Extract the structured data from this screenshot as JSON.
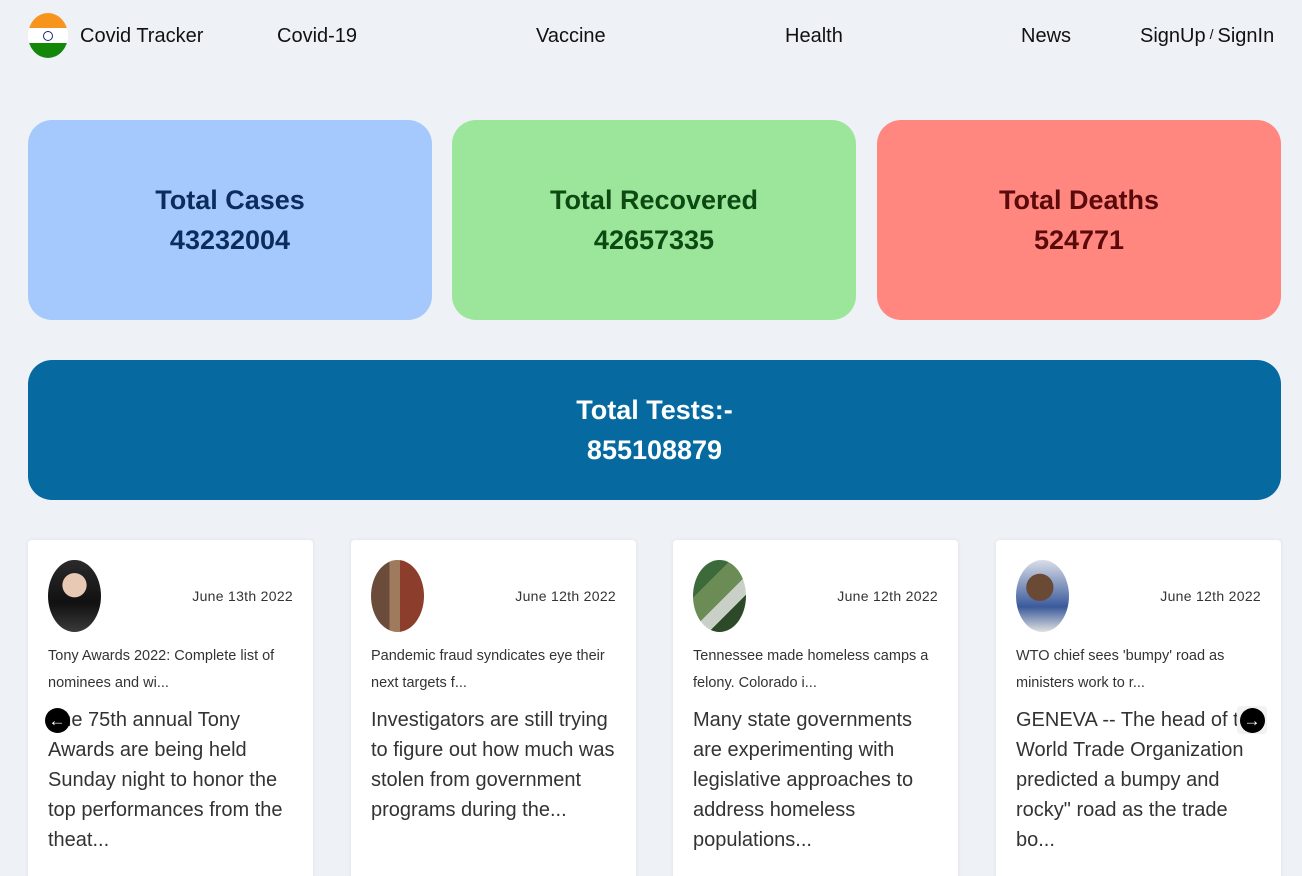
{
  "nav": {
    "brand": "Covid Tracker",
    "items": [
      "Covid-19",
      "Vaccine",
      "Health",
      "News"
    ],
    "signup": "SignUp",
    "separator": "/",
    "signin": "SignIn"
  },
  "stats": {
    "cases": {
      "label": "Total Cases",
      "value": "43232004"
    },
    "recovered": {
      "label": "Total Recovered",
      "value": "42657335"
    },
    "deaths": {
      "label": "Total Deaths",
      "value": "524771"
    },
    "tests": {
      "label": "Total Tests:-",
      "value": "855108879"
    }
  },
  "news": [
    {
      "date": "June 13th 2022",
      "headline": "Tony Awards 2022: Complete list of nominees and wi...",
      "description": "The 75th annual Tony Awards are being held Sunday night to honor the top performances from the theat..."
    },
    {
      "date": "June 12th 2022",
      "headline": "Pandemic fraud syndicates eye their next targets f...",
      "description": "Investigators are still trying to figure out how much was stolen from government programs during the..."
    },
    {
      "date": "June 12th 2022",
      "headline": "Tennessee made homeless camps a felony. Colorado i...",
      "description": "Many state governments are experimenting with legislative approaches to address homeless populations..."
    },
    {
      "date": "June 12th 2022",
      "headline": "WTO chief sees 'bumpy' road as ministers work to r...",
      "description": "GENEVA -- The head of the World Trade Organization predicted a bumpy and rocky\" road as the trade bo..."
    }
  ],
  "carousel": {
    "prev_icon": "arrow-left-circle-icon",
    "next_icon": "arrow-right-circle-icon"
  }
}
